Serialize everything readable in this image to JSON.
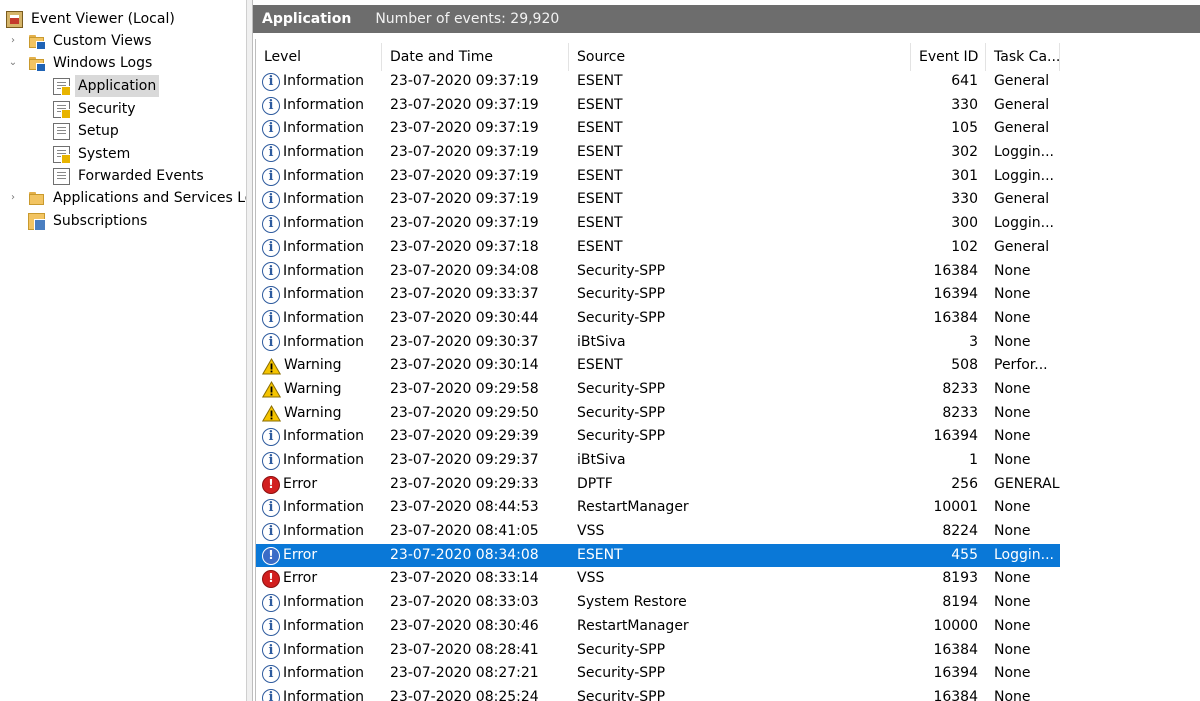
{
  "tree": {
    "root": "Event Viewer (Local)",
    "items": [
      {
        "label": "Custom Views",
        "icon": "custom-views-folder-icon"
      },
      {
        "label": "Windows Logs",
        "icon": "windows-logs-folder-icon"
      },
      {
        "label": "Application",
        "icon": "log-warning-icon",
        "selected": true
      },
      {
        "label": "Security",
        "icon": "log-warning-icon"
      },
      {
        "label": "Setup",
        "icon": "log-icon"
      },
      {
        "label": "System",
        "icon": "log-warning-icon"
      },
      {
        "label": "Forwarded Events",
        "icon": "log-icon"
      },
      {
        "label": "Applications and Services Log",
        "icon": "folder-icon"
      },
      {
        "label": "Subscriptions",
        "icon": "subscriptions-icon"
      }
    ],
    "expand_collapsed": "›",
    "expand_open": "⌄"
  },
  "header": {
    "title": "Application",
    "count": "Number of events: 29,920"
  },
  "columns": {
    "level": "Level",
    "date": "Date and Time",
    "source": "Source",
    "event_id": "Event ID",
    "task": "Task Ca..."
  },
  "rows": [
    {
      "level": "Information",
      "type": "info",
      "date": "23-07-2020 09:37:19",
      "source": "ESENT",
      "id": "641",
      "task": "General"
    },
    {
      "level": "Information",
      "type": "info",
      "date": "23-07-2020 09:37:19",
      "source": "ESENT",
      "id": "330",
      "task": "General"
    },
    {
      "level": "Information",
      "type": "info",
      "date": "23-07-2020 09:37:19",
      "source": "ESENT",
      "id": "105",
      "task": "General"
    },
    {
      "level": "Information",
      "type": "info",
      "date": "23-07-2020 09:37:19",
      "source": "ESENT",
      "id": "302",
      "task": "Loggin..."
    },
    {
      "level": "Information",
      "type": "info",
      "date": "23-07-2020 09:37:19",
      "source": "ESENT",
      "id": "301",
      "task": "Loggin..."
    },
    {
      "level": "Information",
      "type": "info",
      "date": "23-07-2020 09:37:19",
      "source": "ESENT",
      "id": "330",
      "task": "General"
    },
    {
      "level": "Information",
      "type": "info",
      "date": "23-07-2020 09:37:19",
      "source": "ESENT",
      "id": "300",
      "task": "Loggin..."
    },
    {
      "level": "Information",
      "type": "info",
      "date": "23-07-2020 09:37:18",
      "source": "ESENT",
      "id": "102",
      "task": "General"
    },
    {
      "level": "Information",
      "type": "info",
      "date": "23-07-2020 09:34:08",
      "source": "Security-SPP",
      "id": "16384",
      "task": "None"
    },
    {
      "level": "Information",
      "type": "info",
      "date": "23-07-2020 09:33:37",
      "source": "Security-SPP",
      "id": "16394",
      "task": "None"
    },
    {
      "level": "Information",
      "type": "info",
      "date": "23-07-2020 09:30:44",
      "source": "Security-SPP",
      "id": "16384",
      "task": "None"
    },
    {
      "level": "Information",
      "type": "info",
      "date": "23-07-2020 09:30:37",
      "source": "iBtSiva",
      "id": "3",
      "task": "None"
    },
    {
      "level": "Warning",
      "type": "warn",
      "date": "23-07-2020 09:30:14",
      "source": "ESENT",
      "id": "508",
      "task": "Perfor..."
    },
    {
      "level": "Warning",
      "type": "warn",
      "date": "23-07-2020 09:29:58",
      "source": "Security-SPP",
      "id": "8233",
      "task": "None"
    },
    {
      "level": "Warning",
      "type": "warn",
      "date": "23-07-2020 09:29:50",
      "source": "Security-SPP",
      "id": "8233",
      "task": "None"
    },
    {
      "level": "Information",
      "type": "info",
      "date": "23-07-2020 09:29:39",
      "source": "Security-SPP",
      "id": "16394",
      "task": "None"
    },
    {
      "level": "Information",
      "type": "info",
      "date": "23-07-2020 09:29:37",
      "source": "iBtSiva",
      "id": "1",
      "task": "None"
    },
    {
      "level": "Error",
      "type": "err",
      "date": "23-07-2020 09:29:33",
      "source": "DPTF",
      "id": "256",
      "task": "GENERAL"
    },
    {
      "level": "Information",
      "type": "info",
      "date": "23-07-2020 08:44:53",
      "source": "RestartManager",
      "id": "10001",
      "task": "None"
    },
    {
      "level": "Information",
      "type": "info",
      "date": "23-07-2020 08:41:05",
      "source": "VSS",
      "id": "8224",
      "task": "None"
    },
    {
      "level": "Error",
      "type": "err",
      "date": "23-07-2020 08:34:08",
      "source": "ESENT",
      "id": "455",
      "task": "Loggin...",
      "selected": true
    },
    {
      "level": "Error",
      "type": "err",
      "date": "23-07-2020 08:33:14",
      "source": "VSS",
      "id": "8193",
      "task": "None"
    },
    {
      "level": "Information",
      "type": "info",
      "date": "23-07-2020 08:33:03",
      "source": "System Restore",
      "id": "8194",
      "task": "None"
    },
    {
      "level": "Information",
      "type": "info",
      "date": "23-07-2020 08:30:46",
      "source": "RestartManager",
      "id": "10000",
      "task": "None"
    },
    {
      "level": "Information",
      "type": "info",
      "date": "23-07-2020 08:28:41",
      "source": "Security-SPP",
      "id": "16384",
      "task": "None"
    },
    {
      "level": "Information",
      "type": "info",
      "date": "23-07-2020 08:27:21",
      "source": "Security-SPP",
      "id": "16394",
      "task": "None"
    },
    {
      "level": "Information",
      "type": "info",
      "date": "23-07-2020 08:25:24",
      "source": "Security-SPP",
      "id": "16384",
      "task": "None"
    }
  ],
  "colors": {
    "selection": "#0a78d7",
    "header_bar": "#6d6d6d",
    "info_icon": "#2e5b9e",
    "error_icon": "#d21f1f",
    "warning_icon": "#f5c400"
  }
}
